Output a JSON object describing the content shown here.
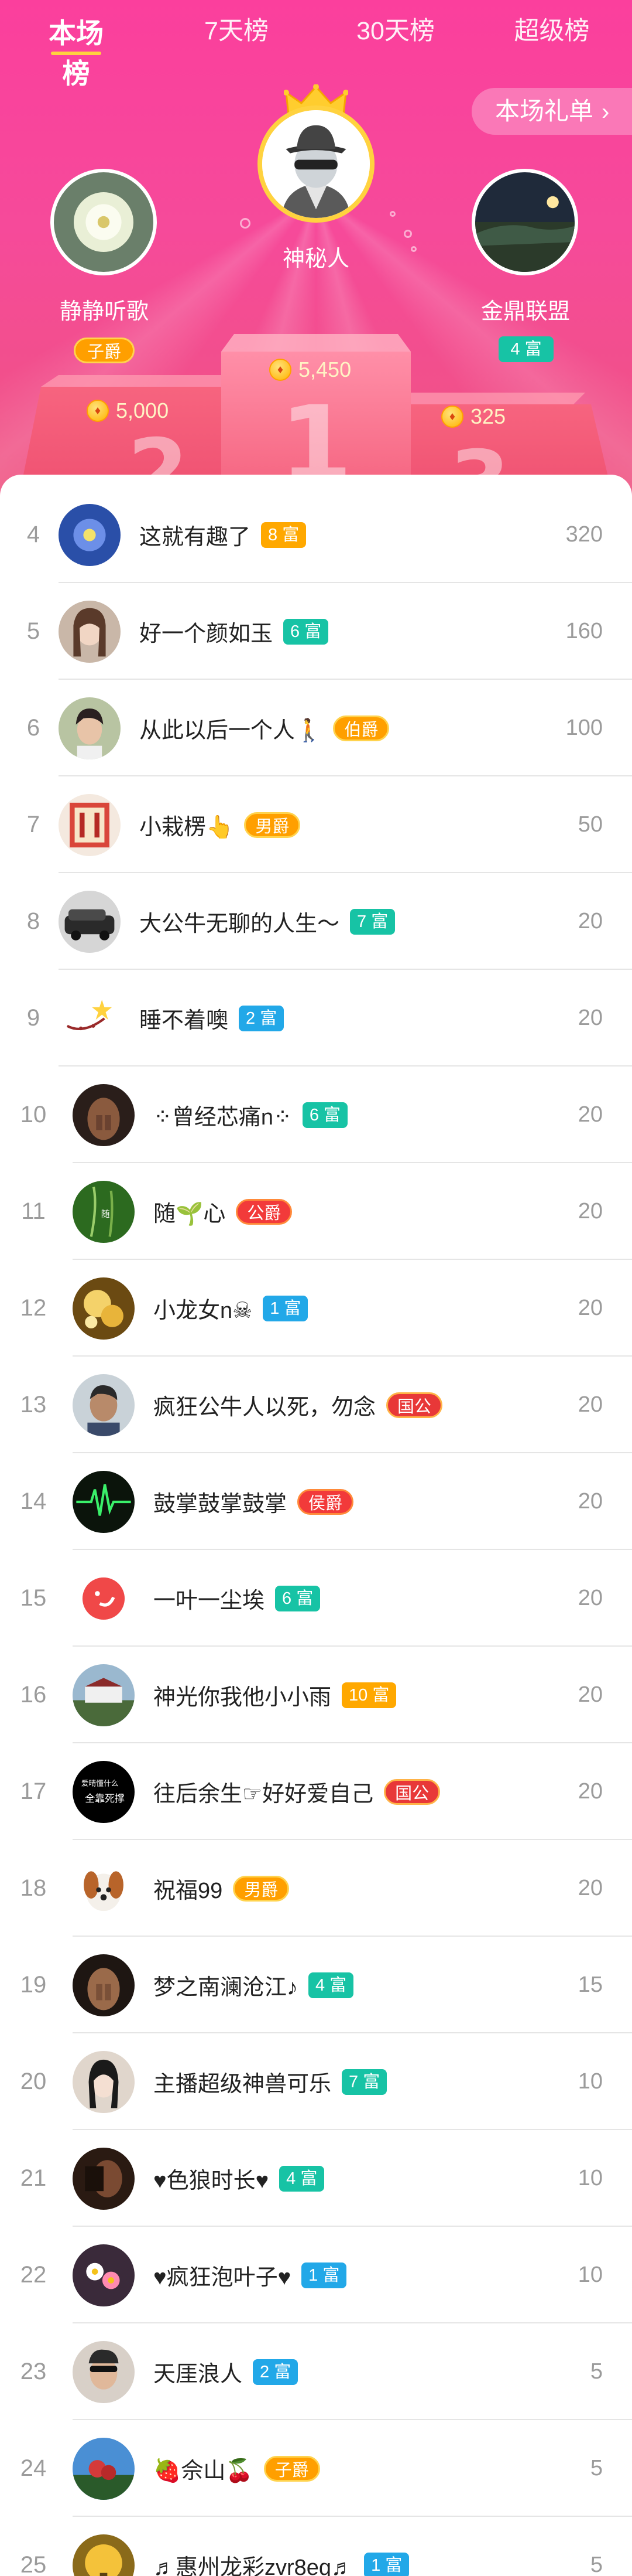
{
  "tabs": [
    "本场榜",
    "7天榜",
    "30天榜",
    "超级榜"
  ],
  "active_tab": 0,
  "gift_list_button": "本场礼单",
  "podium": {
    "first": {
      "name": "神秘人",
      "score": "5,450",
      "avatar": "mystery-man-icon",
      "crown": "crown-icon"
    },
    "second": {
      "name": "静静听歌",
      "badge": "子爵",
      "score": "5,000"
    },
    "third": {
      "name": "金鼎联盟",
      "badge": "4 富",
      "score": "325"
    },
    "stage_numbers": [
      "1",
      "2",
      "3"
    ]
  },
  "colors": {
    "accent": "#fb3f9d",
    "tab_underline": "#ffd23f",
    "badge_teal": "#17c3a5",
    "badge_blue": "#22a8e8",
    "badge_orange": "#ffa800",
    "badge_title_gold": "#ff9f00",
    "badge_title_red": "#f23a3a"
  },
  "ranking": [
    {
      "rank": "4",
      "name": "这就有趣了",
      "badge": "8 富",
      "badge_type": "orange",
      "value": "320"
    },
    {
      "rank": "5",
      "name": "好一个颜如玉",
      "badge": "6 富",
      "badge_type": "teal",
      "value": "160"
    },
    {
      "rank": "6",
      "name": "从此以后一个人🚶",
      "badge": "伯爵",
      "badge_type": "title",
      "value": "100"
    },
    {
      "rank": "7",
      "name": "小栽楞👆",
      "badge": "男爵",
      "badge_type": "title",
      "value": "50"
    },
    {
      "rank": "8",
      "name": "大公牛无聊的人生～",
      "badge": "7 富",
      "badge_type": "teal",
      "value": "20"
    },
    {
      "rank": "9",
      "name": "睡不着噢",
      "badge": "2 富",
      "badge_type": "blue",
      "value": "20"
    },
    {
      "rank": "10",
      "name": "⁘曾经芯痛n⁘",
      "badge": "6 富",
      "badge_type": "teal",
      "value": "20"
    },
    {
      "rank": "11",
      "name": "随🌱心",
      "badge": "公爵",
      "badge_type": "title_red",
      "value": "20"
    },
    {
      "rank": "12",
      "name": "小龙女n☠",
      "badge": "1 富",
      "badge_type": "blue",
      "value": "20"
    },
    {
      "rank": "13",
      "name": "疯狂公牛人以死，勿念",
      "badge": "国公",
      "badge_type": "title_red2",
      "value": "20"
    },
    {
      "rank": "14",
      "name": "鼓掌鼓掌鼓掌",
      "badge": "侯爵",
      "badge_type": "title_red",
      "value": "20"
    },
    {
      "rank": "15",
      "name": "一叶一尘埃",
      "badge": "6 富",
      "badge_type": "teal",
      "value": "20"
    },
    {
      "rank": "16",
      "name": "神光你我他小小雨",
      "badge": "10 富",
      "badge_type": "orange",
      "value": "20"
    },
    {
      "rank": "17",
      "name": "往后余生☞好好爱自己",
      "badge": "国公",
      "badge_type": "title_red2",
      "value": "20"
    },
    {
      "rank": "18",
      "name": "祝福99",
      "badge": "男爵",
      "badge_type": "title",
      "value": "20"
    },
    {
      "rank": "19",
      "name": "梦之南澜沧江♪",
      "badge": "4 富",
      "badge_type": "teal",
      "value": "15"
    },
    {
      "rank": "20",
      "name": "主播超级神兽可乐",
      "badge": "7 富",
      "badge_type": "teal",
      "value": "10"
    },
    {
      "rank": "21",
      "name": "♥色狼时长♥",
      "badge": "4 富",
      "badge_type": "teal",
      "value": "10"
    },
    {
      "rank": "22",
      "name": "♥疯狂泡叶子♥",
      "badge": "1 富",
      "badge_type": "blue",
      "value": "10"
    },
    {
      "rank": "23",
      "name": "天厓浪人",
      "badge": "2 富",
      "badge_type": "blue",
      "value": "5"
    },
    {
      "rank": "24",
      "name": "🍓佘山🍒",
      "badge": "子爵",
      "badge_type": "title",
      "value": "5"
    },
    {
      "rank": "25",
      "name": "♬惠州龙彩zvr8eq♬",
      "badge": "1 富",
      "badge_type": "blue",
      "value": "5"
    }
  ]
}
